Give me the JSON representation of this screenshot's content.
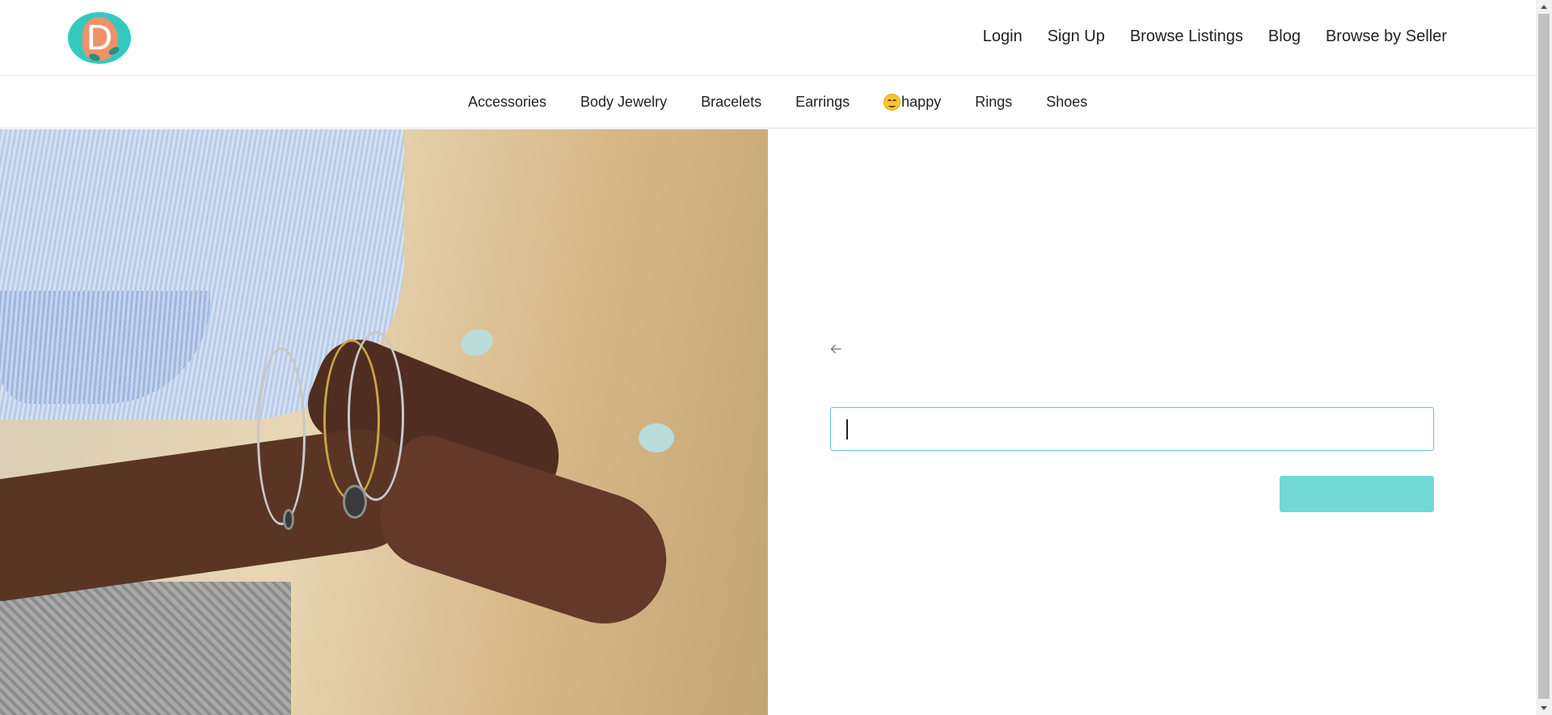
{
  "header": {
    "logo_letter": "D",
    "nav": [
      {
        "label": "Login"
      },
      {
        "label": "Sign Up"
      },
      {
        "label": "Browse Listings"
      },
      {
        "label": "Blog"
      },
      {
        "label": "Browse by Seller"
      }
    ]
  },
  "categories": [
    {
      "label": "Accessories"
    },
    {
      "label": "Body Jewelry"
    },
    {
      "label": "Bracelets"
    },
    {
      "label": "Earrings"
    },
    {
      "label": "happy",
      "icon": "smiling-face-emoji-icon"
    },
    {
      "label": "Rings"
    },
    {
      "label": "Shoes"
    }
  ],
  "hero": {
    "image_subject": "hands-with-bracelets-photo"
  },
  "form": {
    "back_icon": "arrow-left-icon",
    "input_value": "",
    "input_placeholder": "",
    "submit_label": ""
  },
  "colors": {
    "accent": "#73d9d4",
    "input_border": "#6ac7e0",
    "logo_bg": "#34c9c0",
    "logo_blob": "#f0916a"
  }
}
